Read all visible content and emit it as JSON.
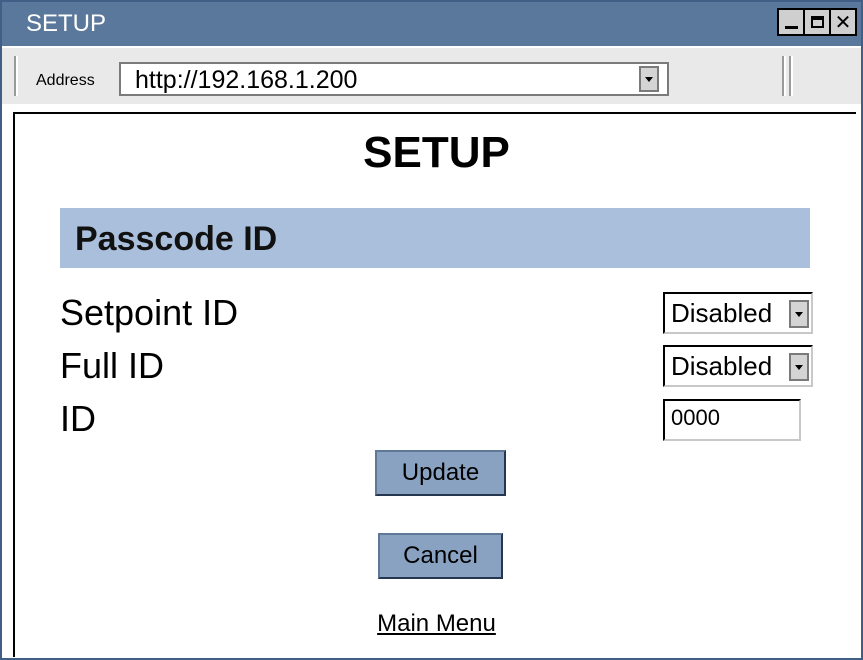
{
  "window": {
    "title": "SETUP"
  },
  "address_bar": {
    "label": "Address",
    "url": "http://192.168.1.200"
  },
  "page": {
    "title": "SETUP",
    "section_title": "Passcode ID",
    "fields": [
      {
        "label": "Setpoint ID",
        "value": "Disabled"
      },
      {
        "label": "Full ID",
        "value": "Disabled"
      },
      {
        "label": "ID",
        "value": "0000"
      }
    ],
    "buttons": {
      "update": "Update",
      "cancel": "Cancel"
    },
    "main_menu_link": "Main Menu"
  },
  "colors": {
    "title_bar": "#5a789b",
    "section_bar": "#aabfdc",
    "button": "#8aa2c1"
  }
}
